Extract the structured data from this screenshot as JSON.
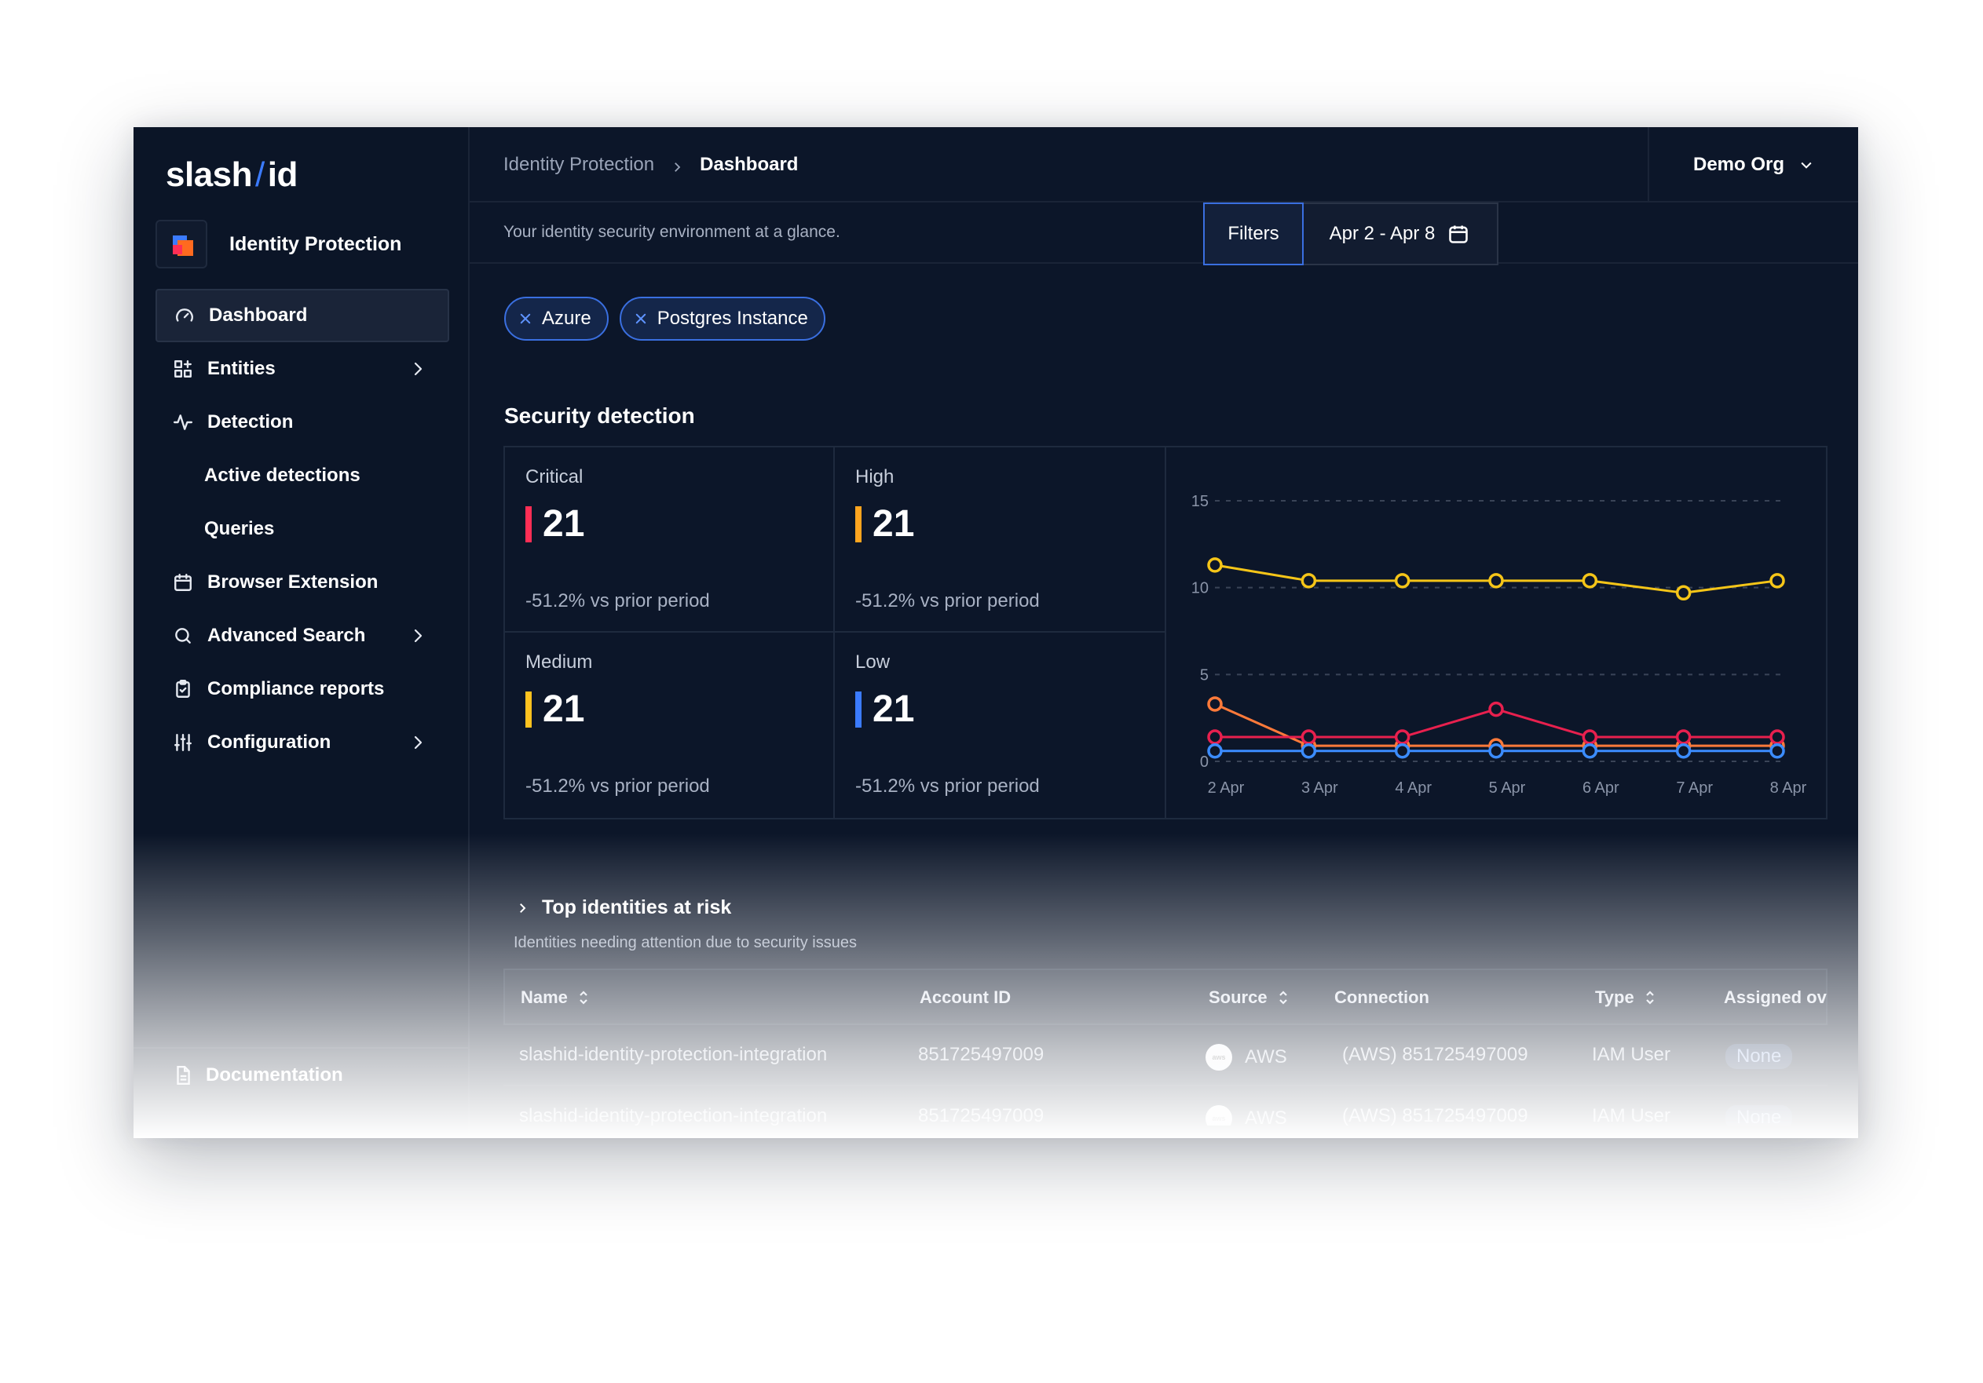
{
  "brand": {
    "name_left": "slash",
    "name_sep": "/",
    "name_right": "id"
  },
  "product": {
    "name": "Identity Protection"
  },
  "sidebar": {
    "items": [
      {
        "label": "Dashboard",
        "icon": "gauge-icon",
        "active": true
      },
      {
        "label": "Entities",
        "icon": "grid-plus-icon",
        "has_chevron": true
      },
      {
        "label": "Detection",
        "icon": "activity-icon"
      },
      {
        "label": "Active detections",
        "sub": true
      },
      {
        "label": "Queries",
        "sub": true
      },
      {
        "label": "Browser Extension",
        "icon": "browser-icon"
      },
      {
        "label": "Advanced Search",
        "icon": "search-icon",
        "has_chevron": true
      },
      {
        "label": "Compliance reports",
        "icon": "clipboard-check-icon"
      },
      {
        "label": "Configuration",
        "icon": "sliders-icon",
        "has_chevron": true
      }
    ],
    "documentation": "Documentation"
  },
  "header": {
    "breadcrumb": [
      "Identity Protection",
      "Dashboard"
    ],
    "org": "Demo Org",
    "subtitle": "Your identity security environment at a glance.",
    "filters_label": "Filters",
    "date_range": "Apr 2 - Apr 8"
  },
  "chips": [
    "Azure",
    "Postgres Instance"
  ],
  "security": {
    "title": "Security detection",
    "cards": [
      {
        "label": "Critical",
        "value": "21",
        "delta": "-51.2% vs prior period",
        "color": "#ff2e55"
      },
      {
        "label": "High",
        "value": "21",
        "delta": "-51.2% vs prior period",
        "color": "#ffa51f"
      },
      {
        "label": "Medium",
        "value": "21",
        "delta": "-51.2% vs prior period",
        "color": "#ffc21f"
      },
      {
        "label": "Low",
        "value": "21",
        "delta": "-51.2% vs prior period",
        "color": "#3b7bff"
      }
    ]
  },
  "chart_data": {
    "type": "line",
    "x": [
      "2 Apr",
      "3 Apr",
      "4 Apr",
      "5 Apr",
      "6 Apr",
      "7 Apr",
      "8 Apr"
    ],
    "ylim": [
      0,
      15
    ],
    "yticks": [
      0,
      5,
      10,
      15
    ],
    "grid": true,
    "series": [
      {
        "color": "#f5c518",
        "values": [
          11.3,
          10.4,
          10.4,
          10.4,
          10.4,
          9.7,
          10.4
        ]
      },
      {
        "color": "#ff7a3a",
        "values": [
          3.3,
          0.9,
          0.9,
          0.9,
          0.9,
          0.9,
          0.9
        ]
      },
      {
        "color": "#e8204e",
        "values": [
          1.4,
          1.4,
          1.4,
          3.0,
          1.4,
          1.4,
          1.4
        ]
      },
      {
        "color": "#3b8cff",
        "values": [
          0.6,
          0.6,
          0.6,
          0.6,
          0.6,
          0.6,
          0.6
        ]
      }
    ]
  },
  "risk": {
    "title": "Top identities at risk",
    "subtitle": "Identities needing attention due to security issues",
    "columns": [
      "Name",
      "Account ID",
      "Source",
      "Connection",
      "Type",
      "Assigned ov"
    ],
    "rows": [
      {
        "name": "slashid-identity-protection-integration",
        "account": "851725497009",
        "source": "AWS",
        "source_icon": "aws",
        "connection": "(AWS) 851725497009",
        "type": "IAM User",
        "assigned": "None"
      },
      {
        "name": "slashid-identity-protection-integration",
        "account": "851725497009",
        "source": "AWS",
        "source_icon": "aws",
        "connection": "(AWS) 851725497009",
        "type": "IAM User",
        "assigned": "None"
      }
    ]
  }
}
